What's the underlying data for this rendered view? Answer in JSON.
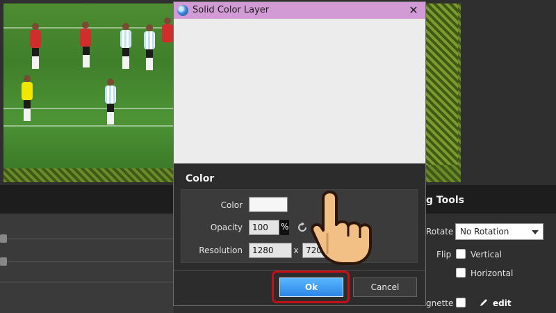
{
  "dialog": {
    "title": "Solid Color Layer",
    "section_title": "Color",
    "color_label": "Color",
    "opacity_label": "Opacity",
    "opacity_value": "100",
    "opacity_unit": "%",
    "resolution_label": "Resolution",
    "resolution_width": "1280",
    "resolution_separator": "x",
    "resolution_height": "720",
    "ok_label": "Ok",
    "cancel_label": "Cancel",
    "close_label": "✕",
    "color_value": "#f6f6f6"
  },
  "right_panel": {
    "title": "g Tools",
    "rotate_label": "Rotate",
    "rotate_value": "No Rotation",
    "flip_label": "Flip",
    "vertical_label": "Vertical",
    "horizontal_label": "Horizontal",
    "vignette_label": "gnette",
    "edit_label": "edit"
  },
  "colors": {
    "titlebar": "#d39bd6",
    "ok_button": "#2b86e6",
    "highlight": "#c40f16"
  }
}
